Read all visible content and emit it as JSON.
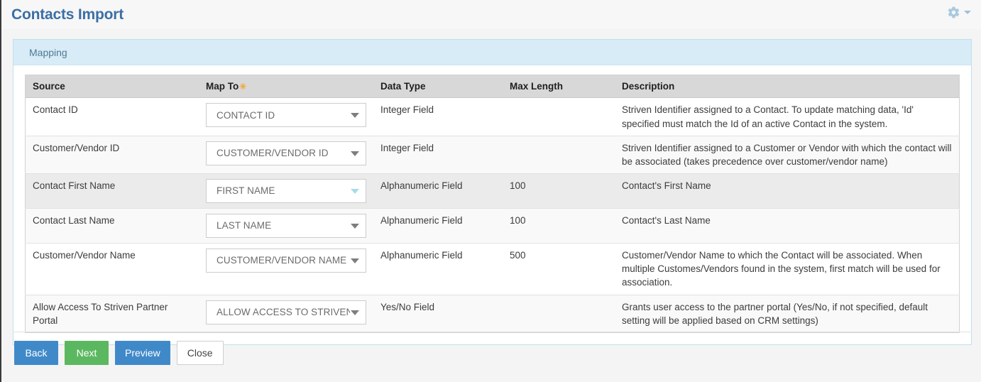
{
  "header": {
    "title": "Contacts Import",
    "gear_icon": "gear-icon",
    "caret_icon": "chevron-down-icon"
  },
  "panel": {
    "section_label": "Mapping"
  },
  "table": {
    "columns": [
      "Source",
      "Map To",
      "Data Type",
      "Max Length",
      "Description"
    ],
    "required_marker": "✳",
    "rows": [
      {
        "source": "Contact ID",
        "map_to": "CONTACT ID",
        "data_type": "Integer Field",
        "max_length": "",
        "description": "Striven Identifier assigned to a Contact. To update matching data, 'Id' specified must match the Id of an active Contact in the system.",
        "state": "plain"
      },
      {
        "source": "Customer/Vendor ID",
        "map_to": "CUSTOMER/VENDOR ID",
        "data_type": "Integer Field",
        "max_length": "",
        "description": "Striven Identifier assigned to a Customer or Vendor with which the contact will be associated (takes precedence over customer/vendor name)",
        "state": "alt"
      },
      {
        "source": "Contact First Name",
        "map_to": "FIRST NAME",
        "data_type": "Alphanumeric Field",
        "max_length": "100",
        "description": "Contact's First Name",
        "state": "hover"
      },
      {
        "source": "Contact Last Name",
        "map_to": "LAST NAME",
        "data_type": "Alphanumeric Field",
        "max_length": "100",
        "description": "Contact's Last Name",
        "state": "alt"
      },
      {
        "source": "Customer/Vendor Name",
        "map_to": "CUSTOMER/VENDOR NAME",
        "data_type": "Alphanumeric Field",
        "max_length": "500",
        "description": "Customer/Vendor Name to which the Contact will be associated. When multiple Customes/Vendors found in the system, first match will be used for association.",
        "state": "plain"
      },
      {
        "source": "Allow Access To Striven Partner Portal",
        "map_to": "ALLOW ACCESS TO STRIVEN PARTNER PORTAL",
        "data_type": "Yes/No Field",
        "max_length": "",
        "description": "Grants user access to the partner portal (Yes/No, if not specified, default setting will be applied based on CRM settings)",
        "state": "alt"
      }
    ]
  },
  "footer": {
    "buttons": [
      {
        "label": "Back",
        "style": "blue"
      },
      {
        "label": "Next",
        "style": "green"
      },
      {
        "label": "Preview",
        "style": "blue"
      },
      {
        "label": "Close",
        "style": "white"
      }
    ]
  },
  "colors": {
    "title_blue": "#3b6ea5",
    "panel_header_bg": "#d7ecf6",
    "panel_border": "#bfe0ef",
    "table_header_bg": "#d8d8d8",
    "required_star": "#f0a93c",
    "button_blue": "#4089c9",
    "button_green": "#5cb860",
    "hover_row_bg": "#ebebeb"
  }
}
